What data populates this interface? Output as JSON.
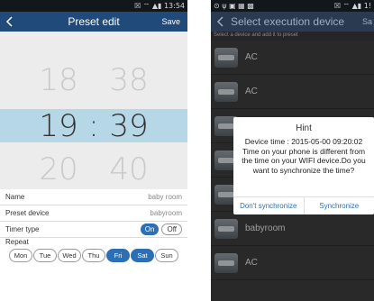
{
  "left": {
    "status": {
      "left": "",
      "right": "☒ ⌔ ▲▮ 13:54"
    },
    "title": "Preset edit",
    "save_label": "Save",
    "picker": {
      "above": {
        "hour": "18",
        "minute": "38"
      },
      "selected": {
        "hour": "19",
        "minute": "39",
        "sep": ":"
      },
      "below": {
        "hour": "20",
        "minute": "40"
      }
    },
    "form": {
      "name_label": "Name",
      "name_value": "baby room",
      "device_label": "Preset device",
      "device_value": "babyroom",
      "timer_label": "Timer type",
      "timer_on": "On",
      "timer_off": "Off",
      "repeat_label": "Repeat"
    },
    "days": [
      {
        "label": "Mon",
        "on": false
      },
      {
        "label": "Tue",
        "on": false
      },
      {
        "label": "Wed",
        "on": false
      },
      {
        "label": "Thu",
        "on": false
      },
      {
        "label": "Fri",
        "on": true
      },
      {
        "label": "Sat",
        "on": true
      },
      {
        "label": "Sun",
        "on": false
      }
    ]
  },
  "right": {
    "status": {
      "left": "⊙ ψ ▣ ▦ ▩",
      "right": "☒ ⌔ ▲▮ 1!"
    },
    "title": "Select execution device",
    "title_action": "Sa",
    "subhint": "Select a device and add it to preset",
    "devices": [
      "AC",
      "AC",
      "",
      "",
      "",
      "babyroom",
      "AC"
    ],
    "dialog": {
      "title": "Hint",
      "body": "Device time : 2015-05-00 09:20:02 Time on your phone is different from the time on your WIFI device.Do you want to synchronize the time?",
      "cancel": "Don't synchronize",
      "confirm": "Synchronize"
    }
  },
  "colors": {
    "title_bar_left": "#1f4a7a",
    "title_bar_right": "#2a3a50",
    "accent": "#2d6fb4",
    "selected_row": "#b6d8e6"
  }
}
